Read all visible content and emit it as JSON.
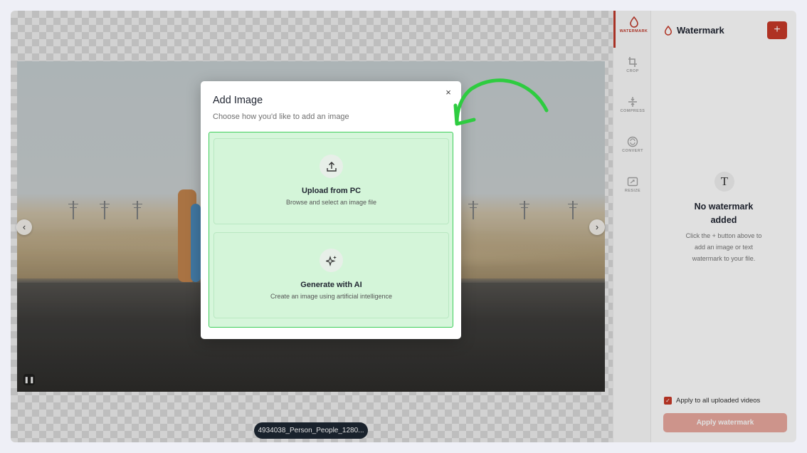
{
  "rail": {
    "tools": [
      {
        "label": "WATERMARK",
        "icon": "droplet-icon",
        "active": true
      },
      {
        "label": "CROP",
        "icon": "crop-icon",
        "active": false
      },
      {
        "label": "COMPRESS",
        "icon": "compress-icon",
        "active": false
      },
      {
        "label": "CONVERT",
        "icon": "convert-icon",
        "active": false
      },
      {
        "label": "RESIZE",
        "icon": "resize-icon",
        "active": false
      }
    ]
  },
  "panel": {
    "title": "Watermark",
    "add_label": "+",
    "empty_icon_glyph": "T",
    "empty_title": "No watermark added",
    "empty_desc": "Click the + button above to add an image or text watermark to your file.",
    "apply_all_label": "Apply to all uploaded videos",
    "apply_all_checked": true,
    "apply_button_label": "Apply watermark"
  },
  "canvas": {
    "filename": "4934038_Person_People_1280...",
    "prev_glyph": "‹",
    "next_glyph": "›",
    "pause_glyph": "❚❚"
  },
  "modal": {
    "title": "Add Image",
    "subtitle": "Choose how you'd like to add an image",
    "close_glyph": "×",
    "options": [
      {
        "title": "Upload from PC",
        "desc": "Browse and select an image file",
        "icon": "upload-icon"
      },
      {
        "title": "Generate with AI",
        "desc": "Create an image using artificial intelligence",
        "icon": "sparkles-icon"
      }
    ]
  },
  "colors": {
    "accent": "#c83a28",
    "highlight_border": "#3fcf5b",
    "highlight_fill": "#d6f6db",
    "annotation_arrow": "#2ecc40"
  }
}
